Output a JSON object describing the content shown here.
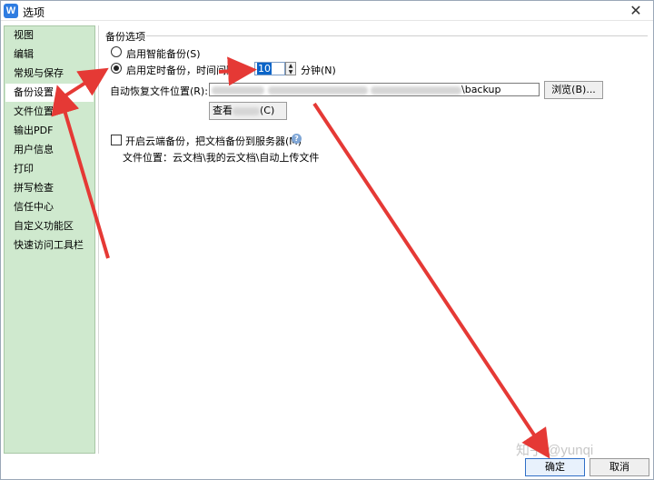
{
  "window": {
    "title": "选项",
    "app_icon": "wps-writer-icon",
    "close_label": "✕"
  },
  "sidebar": {
    "items": [
      {
        "label": "视图",
        "selected": false
      },
      {
        "label": "编辑",
        "selected": false
      },
      {
        "label": "常规与保存",
        "selected": false
      },
      {
        "label": "备份设置",
        "selected": true
      },
      {
        "label": "文件位置",
        "selected": false
      },
      {
        "label": "输出PDF",
        "selected": false
      },
      {
        "label": "用户信息",
        "selected": false
      },
      {
        "label": "打印",
        "selected": false
      },
      {
        "label": "拼写检查",
        "selected": false
      },
      {
        "label": "信任中心",
        "selected": false
      },
      {
        "label": "自定义功能区",
        "selected": false
      },
      {
        "label": "快速访问工具栏",
        "selected": false
      }
    ]
  },
  "backup": {
    "group_title": "备份选项",
    "smart_backup_label": "启用智能备份(S)",
    "timed_backup_label": "启用定时备份，时间间隔(I):",
    "interval_value": "10",
    "interval_unit": "分钟(N)",
    "recovery_path_label": "自动恢复文件位置(R):",
    "recovery_path_value_suffix": "\\backup",
    "browse_button": "浏览(B)...",
    "view_button": "查看",
    "view_button_suffix": "(C)",
    "cloud_backup_label": "开启云端备份，把文档备份到服务器(M)",
    "cloud_path_text": "文件位置：云文档\\我的云文档\\自动上传文件"
  },
  "footer": {
    "ok_button": "确定",
    "cancel_button": "取消",
    "watermark": "知乎 @yunqi"
  },
  "colors": {
    "sidebar_bg": "#cfe9ce",
    "selection": "#0a64c8",
    "annotation_arrow": "#e53935"
  }
}
